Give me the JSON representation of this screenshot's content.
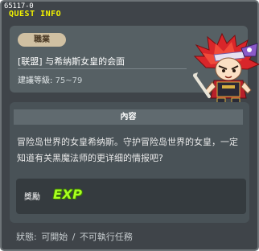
{
  "window": {
    "quest_id": "65117-0",
    "title": "QUEST INFO"
  },
  "info": {
    "job_badge": "職業",
    "quest_name": "[联盟] 与希纳斯女皇的会面",
    "level_label": "建議等級:",
    "level_range": "75~79"
  },
  "content": {
    "header": "內容",
    "text": "冒险岛世界的女皇希纳斯。守护冒险岛世界的女皇，一定知道有关黑魔法师的更详细的情报吧?"
  },
  "reward": {
    "label": "獎勵",
    "exp_icon_text": "EXP"
  },
  "status": {
    "label": "狀態:",
    "value1": "可開始",
    "separator": "/",
    "value2": "不可執行任務"
  },
  "colors": {
    "title_accent": "#f2f200",
    "exp_green": "#a8ff20",
    "panel_bg": "#566064",
    "window_bg": "#3f4449"
  }
}
